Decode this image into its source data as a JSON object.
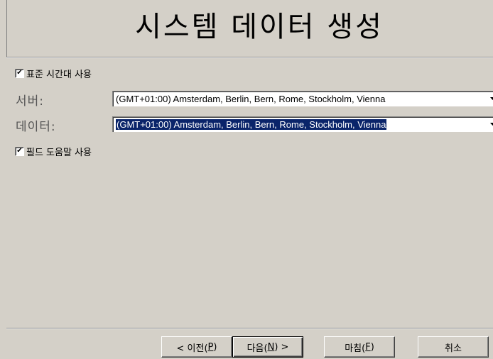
{
  "header": {
    "title": "시스템 데이터 생성"
  },
  "options": {
    "use_standard_timezone": {
      "label": "표준 시간대 사용",
      "checked": true
    },
    "use_field_help": {
      "label": "필드 도움말 사용",
      "checked": true
    }
  },
  "fields": {
    "server": {
      "label": "서버:",
      "value": "(GMT+01:00) Amsterdam, Berlin, Bern, Rome, Stockholm, Vienna"
    },
    "data": {
      "label": "데이터:",
      "value": "(GMT+01:00) Amsterdam, Berlin, Bern, Rome, Stockholm, Vienna"
    }
  },
  "buttons": {
    "back": {
      "prefix": "< 이전(",
      "accel": "P",
      "suffix": ")"
    },
    "next": {
      "prefix": "다음(",
      "accel": "N",
      "suffix": ") >"
    },
    "finish": {
      "prefix": "마침(",
      "accel": "F",
      "suffix": ")"
    },
    "cancel": {
      "label": "취소"
    }
  },
  "icons": {
    "check": "checkmark-icon",
    "dropdown": "dropdown-arrow-icon"
  }
}
